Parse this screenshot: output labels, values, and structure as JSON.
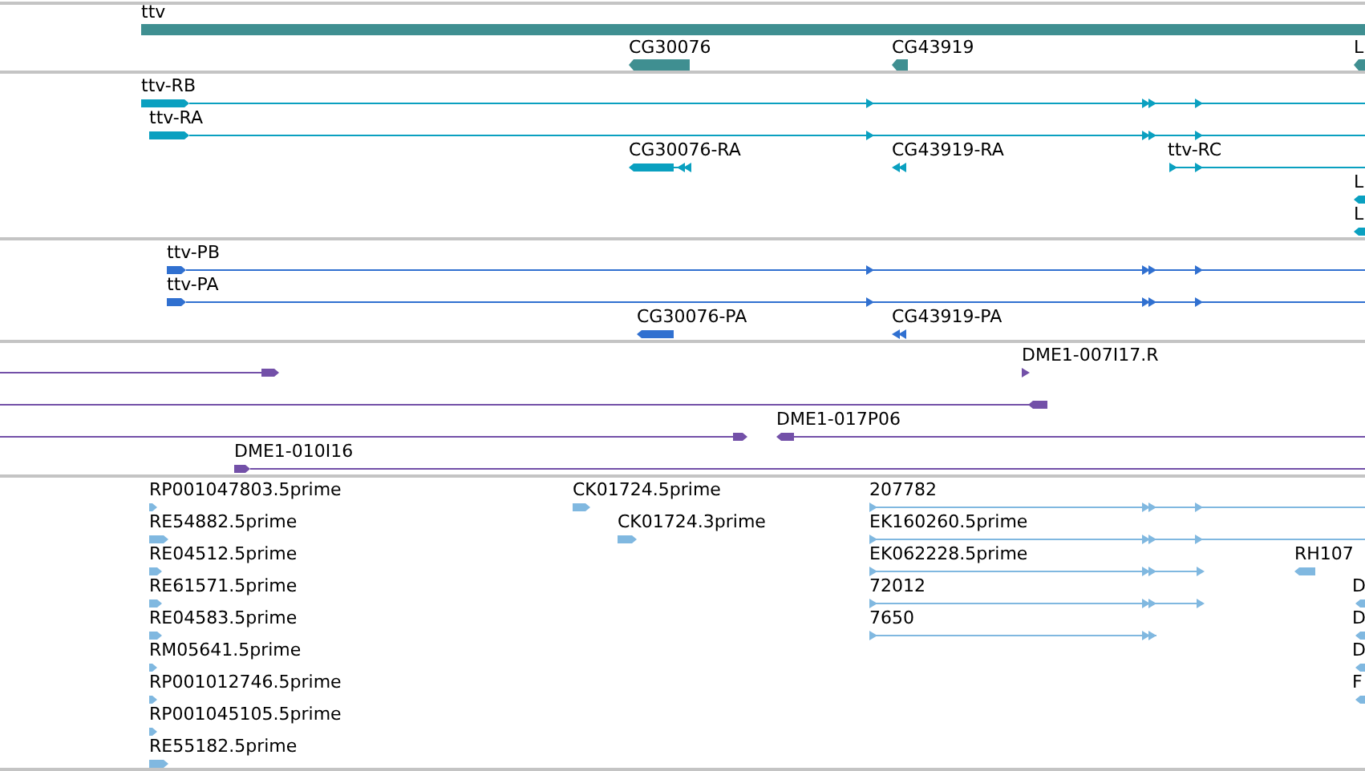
{
  "tracks": [
    {
      "kind": "gene",
      "color": "#3f8f91",
      "features": [
        {
          "label": "ttv"
        },
        {
          "label": "CG30076",
          "reverse": true
        },
        {
          "label": "CG43919",
          "reverse": true
        },
        {
          "label": "L",
          "reverse": true
        }
      ]
    },
    {
      "kind": "transcript",
      "color": "#0aa0c0",
      "features": [
        {
          "label": "ttv-RB",
          "reverse": false
        },
        {
          "label": "ttv-RA",
          "reverse": false
        },
        {
          "label": "CG30076-RA",
          "reverse": true
        },
        {
          "label": "CG43919-RA",
          "reverse": true
        },
        {
          "label": "ttv-RC",
          "reverse": false
        },
        {
          "label": "L",
          "reverse": true
        },
        {
          "label": "L",
          "reverse": true
        }
      ]
    },
    {
      "kind": "protein",
      "color": "#3070d0",
      "features": [
        {
          "label": "ttv-PB",
          "reverse": false
        },
        {
          "label": "ttv-PA",
          "reverse": false
        },
        {
          "label": "CG30076-PA",
          "reverse": true
        },
        {
          "label": "CG43919-PA",
          "reverse": true
        }
      ]
    },
    {
      "kind": "clone",
      "color": "#7350a8",
      "features": [
        {
          "reverse": false
        },
        {
          "label": "DME1-007I17.R",
          "reverse": false
        },
        {
          "reverse": true
        },
        {
          "reverse": false
        },
        {
          "label": "DME1-017P06",
          "reverse": true
        },
        {
          "label": "DME1-010I16",
          "reverse": false
        }
      ]
    },
    {
      "kind": "est",
      "color": "#80b8e0",
      "features": [
        {
          "label": "RP001047803.5prime",
          "reverse": false
        },
        {
          "label": "CK01724.5prime",
          "reverse": false
        },
        {
          "label": "207782",
          "reverse": false
        },
        {
          "label": "RE54882.5prime",
          "reverse": false
        },
        {
          "label": "CK01724.3prime",
          "reverse": false
        },
        {
          "label": "EK160260.5prime",
          "reverse": false
        },
        {
          "label": "RE04512.5prime",
          "reverse": false
        },
        {
          "label": "EK062228.5prime",
          "reverse": false
        },
        {
          "label": "RH107",
          "reverse": true
        },
        {
          "label": "RE61571.5prime",
          "reverse": false
        },
        {
          "label": "72012",
          "reverse": false
        },
        {
          "label": "D",
          "reverse": true
        },
        {
          "label": "RE04583.5prime",
          "reverse": false
        },
        {
          "label": "7650",
          "reverse": false
        },
        {
          "label": "D",
          "reverse": true
        },
        {
          "label": "RM05641.5prime",
          "reverse": false
        },
        {
          "label": "D",
          "reverse": true
        },
        {
          "label": "RP001012746.5prime",
          "reverse": false
        },
        {
          "label": "F",
          "reverse": true
        },
        {
          "label": "RP001045105.5prime",
          "reverse": false
        },
        {
          "label": "RE55182.5prime",
          "reverse": false
        }
      ]
    }
  ]
}
